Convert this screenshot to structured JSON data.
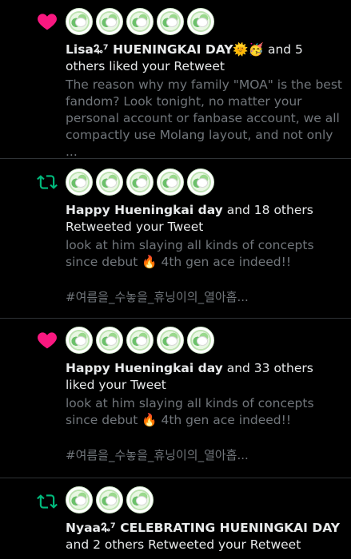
{
  "notifications": [
    {
      "type": "like",
      "icon": "heart-icon",
      "icon_color": "#f91880",
      "avatar_count": 5,
      "actor": "Lisa🜩⁷ HUENINGKAI DAY🌞🥳",
      "action": " and 5 others liked your Retweet",
      "excerpt": "The reason why my family \"MOA\" is the best fandom? Look tonight, no matter your personal account or fanbase account, we all compactly use Molang layout, and not only ..."
    },
    {
      "type": "retweet",
      "icon": "retweet-icon",
      "icon_color": "#00ba7c",
      "avatar_count": 5,
      "actor": "Happy Hueningkai day",
      "action": " and 18 others Retweeted your Tweet",
      "excerpt": "look at him slaying all kinds of concepts since debut 🔥 4th gen ace indeed!!",
      "tags": "#여름을_수놓을_휴닝이의_열아홉..."
    },
    {
      "type": "like",
      "icon": "heart-icon",
      "icon_color": "#f91880",
      "avatar_count": 5,
      "actor": "Happy Hueningkai day",
      "action": " and 33 others liked your Tweet",
      "excerpt": "look at him slaying all kinds of concepts since debut 🔥 4th gen ace indeed!!",
      "tags": "#여름을_수놓을_휴닝이의_열아홉..."
    },
    {
      "type": "retweet",
      "icon": "retweet-icon",
      "icon_color": "#00ba7c",
      "avatar_count": 3,
      "actor": "Nyaa🜩⁷ CELEBRATING HUENINGKAI DAY",
      "action": " and 2 others Retweeted your Retweet"
    }
  ]
}
